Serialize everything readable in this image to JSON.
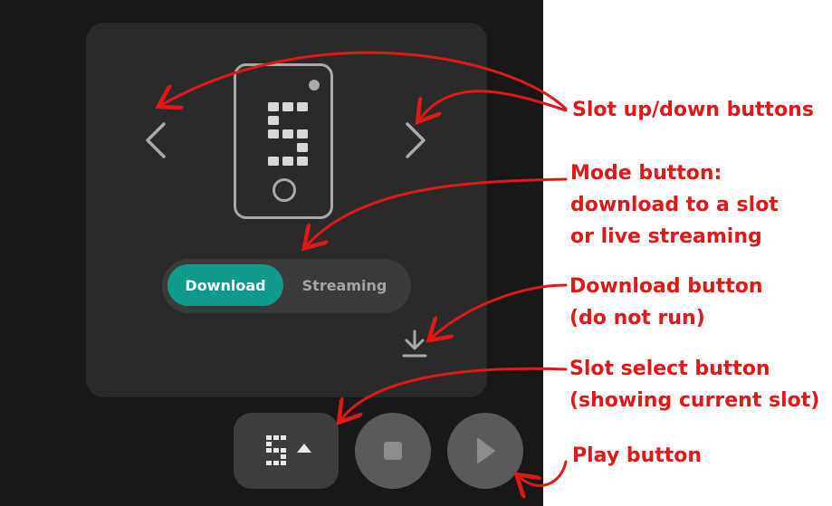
{
  "mode_toggle": {
    "download_label": "Download",
    "streaming_label": "Streaming",
    "selected": "Download"
  },
  "current_slot": 5,
  "colors": {
    "accent": "#0f9a8c",
    "annotation": "#e01818",
    "icon_gray": "#a9a9a9"
  },
  "icons": {
    "prev": "chevron-left-icon",
    "next": "chevron-right-icon",
    "download": "download-icon",
    "slot_caret": "caret-up-icon",
    "stop": "stop-icon",
    "play": "play-icon"
  },
  "annotations": {
    "slot_buttons": "Slot up/down buttons",
    "mode_line1": "Mode button:",
    "mode_line2": "download to a slot",
    "mode_line3": "or live streaming",
    "download_line1": "Download button",
    "download_line2": "(do not run)",
    "slot_select_line1": "Slot select button",
    "slot_select_line2": "(showing current slot)",
    "play": "Play button"
  }
}
